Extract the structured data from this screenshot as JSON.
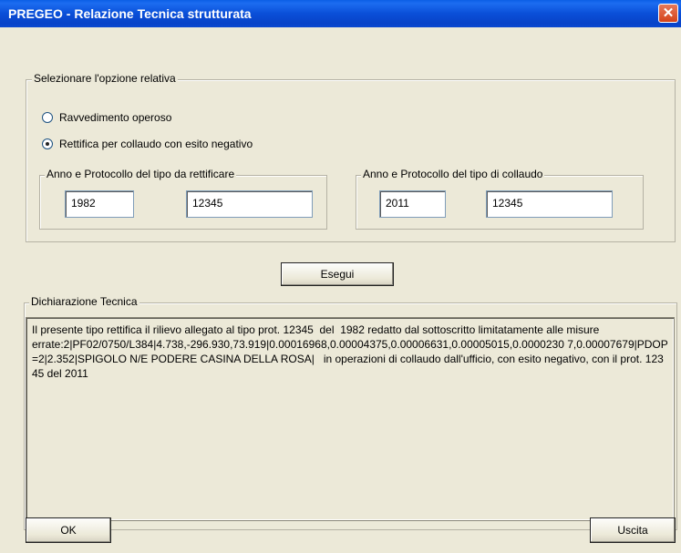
{
  "window": {
    "title": "PREGEO - Relazione Tecnica strutturata",
    "close_glyph": "✕"
  },
  "options": {
    "legend": "Selezionare l'opzione relativa",
    "radio1": "Ravvedimento operoso",
    "radio2": "Rettifica per collaudo con esito negativo",
    "selected": "radio2"
  },
  "rettificare": {
    "legend": "Anno e Protocollo del tipo da rettificare",
    "anno": "1982",
    "protocollo": "12345"
  },
  "collaudo": {
    "legend": "Anno e Protocollo del tipo di collaudo",
    "anno": "2011",
    "protocollo": "12345"
  },
  "buttons": {
    "esegui": "Esegui",
    "ok": "OK",
    "uscita": "Uscita"
  },
  "dichiarazione": {
    "legend": "Dichiarazione Tecnica",
    "text": "Il presente tipo rettifica il rilievo allegato al tipo prot. 12345  del  1982 redatto dal sottoscritto limitatamente alle misure\nerrate:2|PF02/0750/L384|4.738,-296.930,73.919|0.00016968,0.00004375,0.00006631,0.00005015,0.0000230 7,0.00007679|PDOP=2|2.352|SPIGOLO N/E PODERE CASINA DELLA ROSA|   in operazioni di collaudo dall'ufficio, con esito negativo, con il prot. 12345 del 2011"
  },
  "colors": {
    "title_bar": "#0a4fd8",
    "dialog_bg": "#ece9d8",
    "close_button": "#d4431a"
  }
}
